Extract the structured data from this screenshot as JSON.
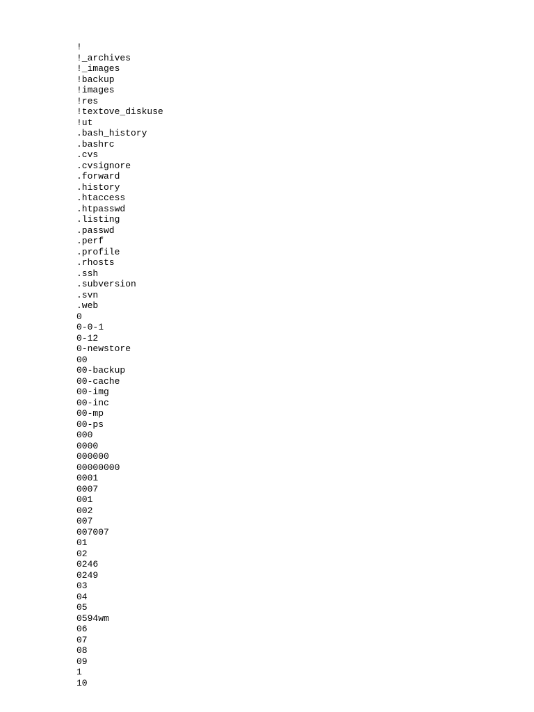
{
  "lines": [
    "!",
    "!_archives",
    "!_images",
    "!backup",
    "!images",
    "!res",
    "!textove_diskuse",
    "!ut",
    ".bash_history",
    ".bashrc",
    ".cvs",
    ".cvsignore",
    ".forward",
    ".history",
    ".htaccess",
    ".htpasswd",
    ".listing",
    ".passwd",
    ".perf",
    ".profile",
    ".rhosts",
    ".ssh",
    ".subversion",
    ".svn",
    ".web",
    "0",
    "0-0-1",
    "0-12",
    "0-newstore",
    "00",
    "00-backup",
    "00-cache",
    "00-img",
    "00-inc",
    "00-mp",
    "00-ps",
    "000",
    "0000",
    "000000",
    "00000000",
    "0001",
    "0007",
    "001",
    "002",
    "007",
    "007007",
    "01",
    "02",
    "0246",
    "0249",
    "03",
    "04",
    "05",
    "0594wm",
    "06",
    "07",
    "08",
    "09",
    "1",
    "10"
  ]
}
